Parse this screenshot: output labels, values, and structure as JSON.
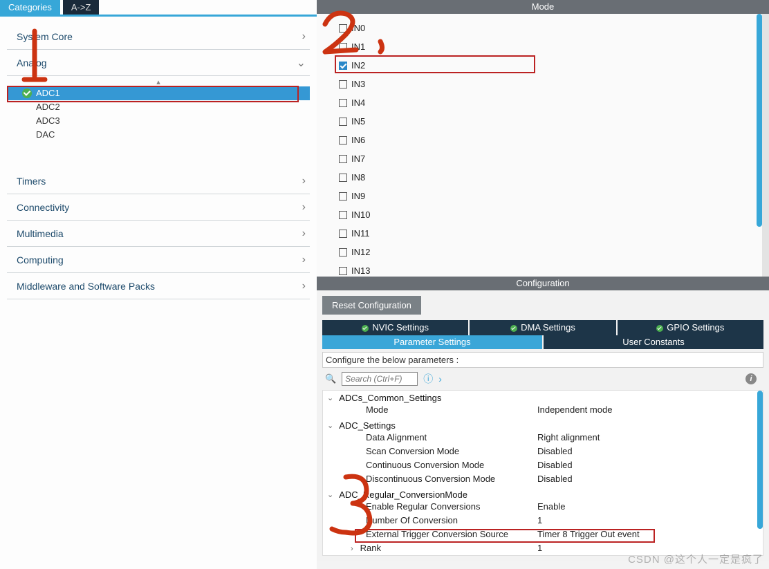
{
  "left_tabs": {
    "categories": "Categories",
    "az": "A->Z"
  },
  "categories": {
    "system_core": "System Core",
    "analog": "Analog",
    "analog_items": [
      "ADC1",
      "ADC2",
      "ADC3",
      "DAC"
    ],
    "timers": "Timers",
    "connectivity": "Connectivity",
    "multimedia": "Multimedia",
    "computing": "Computing",
    "middleware": "Middleware and Software Packs"
  },
  "mode": {
    "title": "Mode",
    "channels": [
      "IN0",
      "IN1",
      "IN2",
      "IN3",
      "IN4",
      "IN5",
      "IN6",
      "IN7",
      "IN8",
      "IN9",
      "IN10",
      "IN11",
      "IN12",
      "IN13"
    ],
    "checked_index": 2
  },
  "configuration": {
    "title": "Configuration",
    "reset": "Reset Configuration",
    "tabs_top": {
      "nvic": "NVIC Settings",
      "dma": "DMA Settings",
      "gpio": "GPIO Settings"
    },
    "tabs_second": {
      "param": "Parameter Settings",
      "user": "User Constants"
    },
    "hint": "Configure the below parameters :",
    "search_placeholder": "Search (Ctrl+F)",
    "groups": [
      {
        "name": "ADCs_Common_Settings",
        "rows": [
          {
            "name": "Mode",
            "value": "Independent mode"
          }
        ]
      },
      {
        "name": "ADC_Settings",
        "rows": [
          {
            "name": "Data Alignment",
            "value": "Right alignment"
          },
          {
            "name": "Scan Conversion Mode",
            "value": "Disabled"
          },
          {
            "name": "Continuous Conversion Mode",
            "value": "Disabled"
          },
          {
            "name": "Discontinuous Conversion Mode",
            "value": "Disabled"
          }
        ]
      },
      {
        "name": "ADC_Regular_ConversionMode",
        "rows": [
          {
            "name": "Enable Regular Conversions",
            "value": "Enable"
          },
          {
            "name": "Number Of Conversion",
            "value": "1"
          },
          {
            "name": "External Trigger Conversion Source",
            "value": "Timer 8 Trigger Out event"
          },
          {
            "name": "Rank",
            "value": "1"
          }
        ]
      }
    ]
  },
  "watermark": "CSDN @这个人一定是疯了"
}
